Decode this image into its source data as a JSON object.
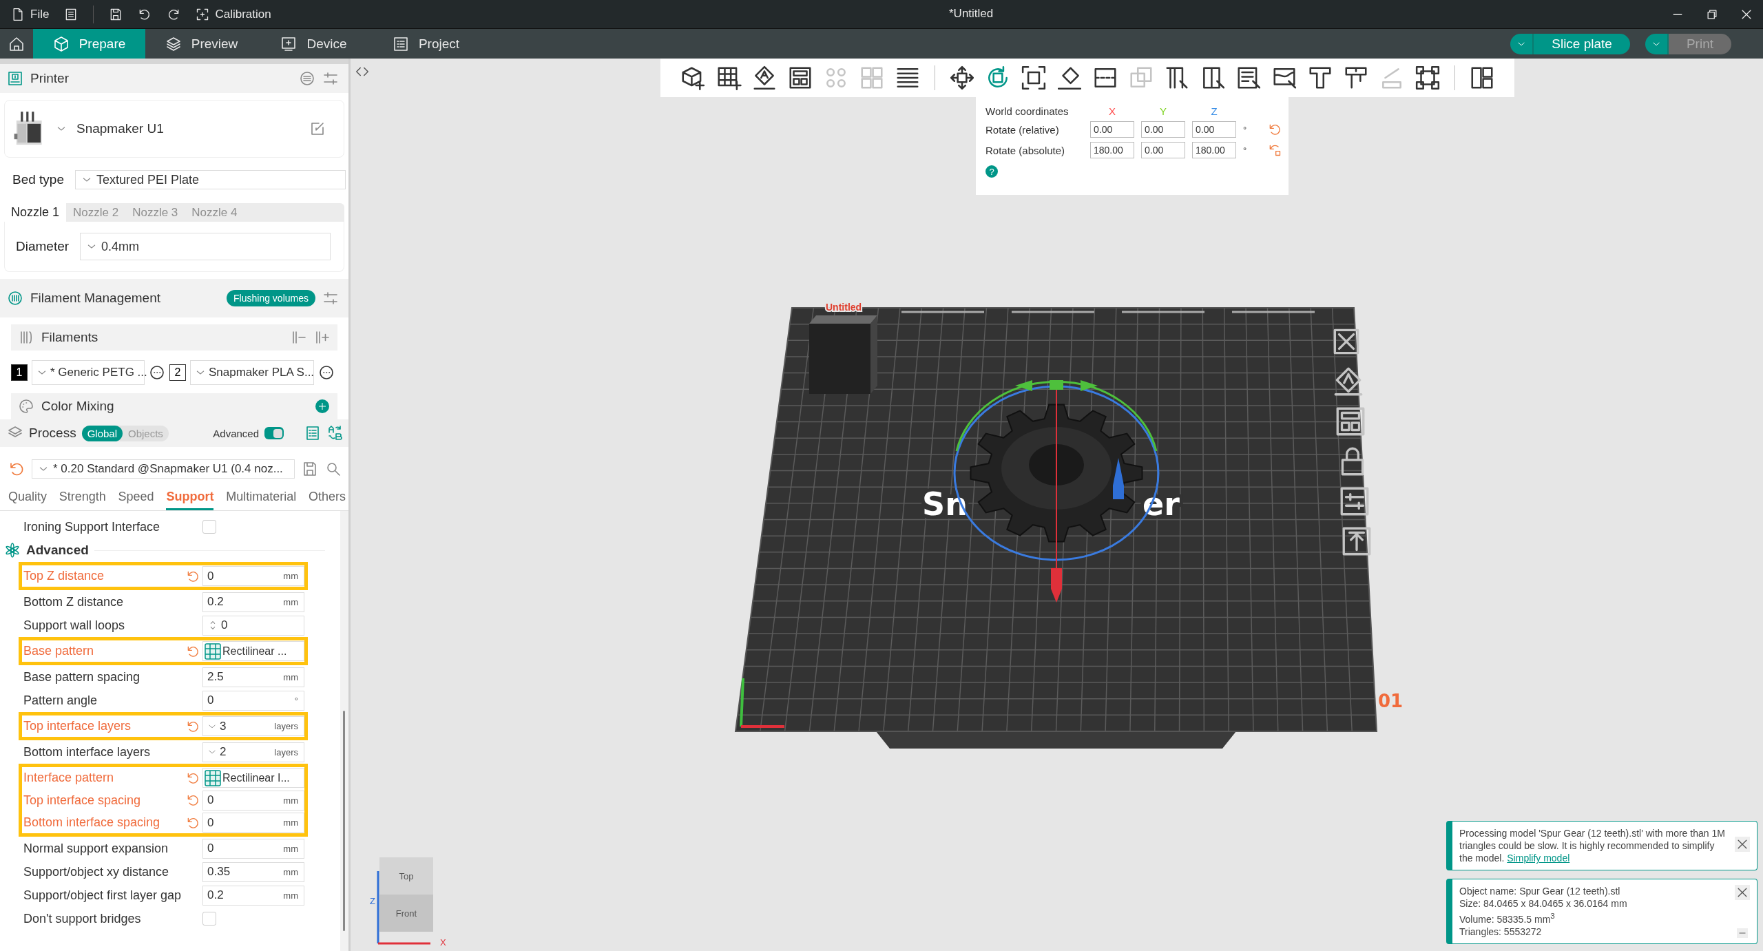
{
  "title_bar": {
    "file": "File",
    "calibration": "Calibration",
    "title": "*Untitled"
  },
  "tabs": [
    {
      "label": "Prepare",
      "selected": true
    },
    {
      "label": "Preview",
      "selected": false
    },
    {
      "label": "Device",
      "selected": false
    },
    {
      "label": "Project",
      "selected": false
    }
  ],
  "slice_button": "Slice plate",
  "print_button": {
    "label": "Print",
    "disabled": true
  },
  "printer": {
    "header": "Printer",
    "name": "Snapmaker U1",
    "bed_type_label": "Bed type",
    "bed_type": "Textured PEI Plate",
    "nozzles": [
      {
        "label": "Nozzle 1",
        "selected": true
      },
      {
        "label": "Nozzle 2",
        "selected": false
      },
      {
        "label": "Nozzle 3",
        "selected": false
      },
      {
        "label": "Nozzle 4",
        "selected": false
      }
    ],
    "diameter_label": "Diameter",
    "diameter": "0.4mm"
  },
  "filament": {
    "header": "Filament Management",
    "flushing": "Flushing volumes",
    "list_label": "Filaments",
    "items": [
      {
        "index": "1",
        "name": "* Generic PETG ...",
        "color": "#000000"
      },
      {
        "index": "2",
        "name": "Snapmaker PLA S...",
        "color": "#ffffff"
      }
    ],
    "color_mixing": "Color Mixing"
  },
  "process": {
    "header": "Process",
    "scopes": [
      {
        "label": "Global",
        "selected": true
      },
      {
        "label": "Objects",
        "selected": false
      }
    ],
    "advanced_label": "Advanced",
    "advanced_on": true,
    "preset": "* 0.20 Standard @Snapmaker U1 (0.4 noz...",
    "tabs": [
      {
        "label": "Quality",
        "selected": false
      },
      {
        "label": "Strength",
        "selected": false
      },
      {
        "label": "Speed",
        "selected": false
      },
      {
        "label": "Support",
        "selected": true
      },
      {
        "label": "Multimaterial",
        "selected": false
      },
      {
        "label": "Others",
        "selected": false
      }
    ]
  },
  "settings": [
    {
      "kind": "checkbox",
      "label": "Ironing Support Interface",
      "checked": false
    },
    {
      "kind": "group",
      "label": "Advanced"
    },
    {
      "kind": "number",
      "label": "Top Z distance",
      "value": "0",
      "unit": "mm",
      "modified": true
    },
    {
      "kind": "number",
      "label": "Bottom Z distance",
      "value": "0.2",
      "unit": "mm",
      "modified": false
    },
    {
      "kind": "spinner",
      "label": "Support wall loops",
      "value": "0",
      "modified": false
    },
    {
      "kind": "pattern",
      "label": "Base pattern",
      "value": "Rectilinear ...",
      "modified": true
    },
    {
      "kind": "number",
      "label": "Base pattern spacing",
      "value": "2.5",
      "unit": "mm",
      "modified": false
    },
    {
      "kind": "number",
      "label": "Pattern angle",
      "value": "0",
      "unit": "°",
      "modified": false
    },
    {
      "kind": "dropdown",
      "label": "Top interface layers",
      "value": "3",
      "unit": "layers",
      "modified": true
    },
    {
      "kind": "dropdown",
      "label": "Bottom interface layers",
      "value": "2",
      "unit": "layers",
      "modified": false
    },
    {
      "kind": "pattern",
      "label": "Interface pattern",
      "value": "Rectilinear I...",
      "modified": true
    },
    {
      "kind": "number",
      "label": "Top interface spacing",
      "value": "0",
      "unit": "mm",
      "modified": true
    },
    {
      "kind": "number",
      "label": "Bottom interface spacing",
      "value": "0",
      "unit": "mm",
      "modified": true
    },
    {
      "kind": "number",
      "label": "Normal support expansion",
      "value": "0",
      "unit": "mm",
      "modified": false
    },
    {
      "kind": "number",
      "label": "Support/object xy distance",
      "value": "0.35",
      "unit": "mm",
      "modified": false
    },
    {
      "kind": "number",
      "label": "Support/object first layer gap",
      "value": "0.2",
      "unit": "mm",
      "modified": false
    },
    {
      "kind": "checkbox",
      "label": "Don't support bridges",
      "checked": false
    }
  ],
  "toolbar": [
    {
      "kind": "tool",
      "selected": false,
      "disabled": false
    },
    {
      "kind": "tool",
      "selected": false,
      "disabled": false
    },
    {
      "kind": "tool",
      "selected": false,
      "disabled": false
    },
    {
      "kind": "tool",
      "selected": false,
      "disabled": false
    },
    {
      "kind": "tool",
      "selected": false,
      "disabled": true
    },
    {
      "kind": "tool",
      "selected": false,
      "disabled": true
    },
    {
      "kind": "tool",
      "selected": false,
      "disabled": false
    },
    {
      "kind": "separator"
    },
    {
      "kind": "tool",
      "selected": false,
      "disabled": false
    },
    {
      "kind": "tool",
      "selected": true,
      "disabled": false
    },
    {
      "kind": "tool",
      "selected": false,
      "disabled": false
    },
    {
      "kind": "tool",
      "selected": false,
      "disabled": false
    },
    {
      "kind": "tool",
      "selected": false,
      "disabled": false
    },
    {
      "kind": "tool",
      "selected": false,
      "disabled": true
    },
    {
      "kind": "tool",
      "selected": false,
      "disabled": false
    },
    {
      "kind": "tool",
      "selected": false,
      "disabled": false
    },
    {
      "kind": "tool",
      "selected": false,
      "disabled": false
    },
    {
      "kind": "tool",
      "selected": false,
      "disabled": false
    },
    {
      "kind": "tool",
      "selected": false,
      "disabled": false
    },
    {
      "kind": "tool",
      "selected": false,
      "disabled": false
    },
    {
      "kind": "tool",
      "selected": false,
      "disabled": true
    },
    {
      "kind": "tool",
      "selected": false,
      "disabled": false
    },
    {
      "kind": "separator"
    },
    {
      "kind": "tool",
      "selected": false,
      "disabled": false
    }
  ],
  "rotate_panel": {
    "header": "World coordinates",
    "axes": [
      {
        "label": "X",
        "color": "#ff4d4d"
      },
      {
        "label": "Y",
        "color": "#7ed321"
      },
      {
        "label": "Z",
        "color": "#3a8ee6"
      }
    ],
    "rows": [
      {
        "label": "Rotate (relative)",
        "values": [
          "0.00",
          "0.00",
          "0.00"
        ],
        "unit": "°"
      },
      {
        "label": "Rotate (absolute)",
        "values": [
          "180.00",
          "0.00",
          "180.00"
        ],
        "unit": "°"
      }
    ],
    "help": "?"
  },
  "viewport": {
    "plate_name": "Untitled",
    "plate_number": "01",
    "bed_logo": [
      "Sn",
      "er"
    ],
    "view_cube": {
      "top": "Top",
      "front": "Front"
    },
    "axes": [
      {
        "label": "Z",
        "color": "#2f6fd6"
      },
      {
        "label": "X",
        "color": "#e0303a"
      }
    ]
  },
  "notifications": [
    {
      "kind": "warning",
      "text": "Processing model 'Spur Gear (12 teeth).stl' with more than 1M triangles could be slow. It is highly recommended to simplify the model.",
      "link": "Simplify model"
    },
    {
      "kind": "info",
      "lines": [
        "Object name: Spur Gear (12 teeth).stl",
        "Size: 84.0465 x 84.0465 x 36.0164 mm",
        "Volume: 58335.5 mm$^{3}$",
        "Triangles: 5553272"
      ]
    }
  ]
}
